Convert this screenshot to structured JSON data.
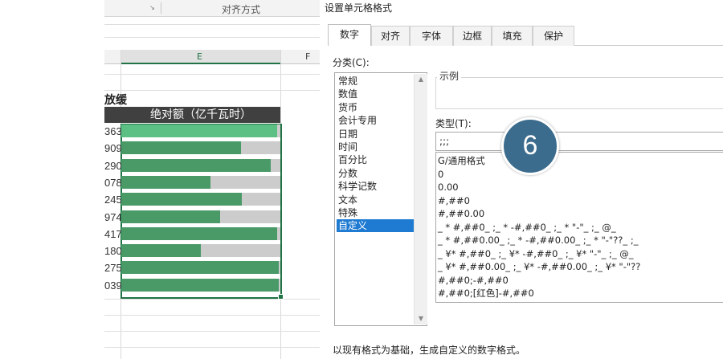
{
  "ribbon": {
    "group_label": "对齐方式"
  },
  "sheet": {
    "columns": {
      "selected": "E",
      "next": "F"
    },
    "title": "放缓",
    "table_header": "绝对额（亿千瓦时）",
    "rows": [
      {
        "value": "363",
        "fill": 0.98
      },
      {
        "value": "909",
        "fill": 0.75
      },
      {
        "value": "290",
        "fill": 0.94
      },
      {
        "value": "078",
        "fill": 0.56
      },
      {
        "value": "245",
        "fill": 0.76
      },
      {
        "value": "974",
        "fill": 0.62
      },
      {
        "value": "417",
        "fill": 0.98
      },
      {
        "value": "180",
        "fill": 0.5
      },
      {
        "value": "275",
        "fill": 0.99
      },
      {
        "value": "039",
        "fill": 0.99
      }
    ]
  },
  "dialog": {
    "title": "设置单元格格式",
    "tabs": [
      "数字",
      "对齐",
      "字体",
      "边框",
      "填充",
      "保护"
    ],
    "active_tab": "数字",
    "category_label": "分类(C):",
    "categories": [
      "常规",
      "数值",
      "货币",
      "会计专用",
      "日期",
      "时间",
      "百分比",
      "分数",
      "科学记数",
      "文本",
      "特殊",
      "自定义"
    ],
    "selected_category": "自定义",
    "sample_label": "示例",
    "type_label": "类型(T):",
    "type_value": ";;;",
    "formats": [
      "G/通用格式",
      "0",
      "0.00",
      "#,##0",
      "#,##0.00",
      "_ * #,##0_ ;_ * -#,##0_ ;_ * \"-\"_ ;_ @_",
      "_ * #,##0.00_ ;_ * -#,##0.00_ ;_ * \"-\"??_ ;_",
      "_ ¥* #,##0_ ;_ ¥* -#,##0_ ;_ ¥* \"-\"_ ;_ @_",
      "_ ¥* #,##0.00_ ;_ ¥* -#,##0.00_ ;_ ¥* \"-\"??",
      "#,##0;-#,##0",
      "#,##0;[红色]-#,##0"
    ],
    "footer": "以现有格式为基础，生成自定义的数字格式。"
  },
  "badge": {
    "number": "6",
    "color": "#3c6c8d"
  },
  "colors": {
    "bar_fill": "#4a9a68",
    "bar_fill_first": "#5cbf84",
    "bar_track": "#cccccc",
    "selection": "#217346",
    "list_selected": "#1f7bd2"
  }
}
